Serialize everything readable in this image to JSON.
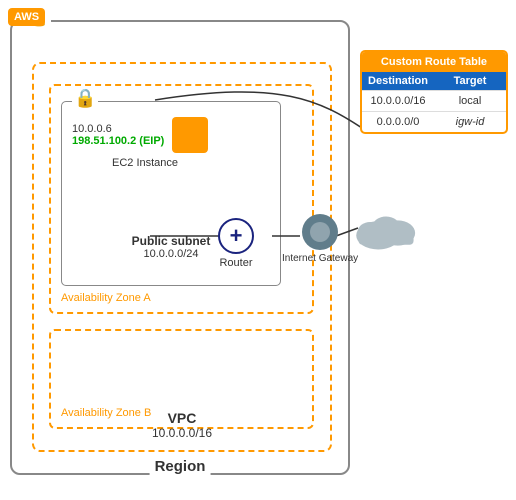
{
  "aws": {
    "badge_label": "AWS"
  },
  "region": {
    "label": "Region"
  },
  "vpc": {
    "label": "VPC",
    "cidr": "10.0.0.0/16"
  },
  "az_a": {
    "label": "Availability Zone A"
  },
  "az_b": {
    "label": "Availability Zone B"
  },
  "subnet": {
    "label": "Public subnet",
    "cidr": "10.0.0.0/24"
  },
  "ec2": {
    "private_ip": "10.0.0.6",
    "eip": "198.51.100.2 (EIP)",
    "label": "EC2 Instance"
  },
  "router": {
    "label": "Router"
  },
  "igw": {
    "label": "Internet Gateway"
  },
  "route_table": {
    "title": "Custom Route Table",
    "col_destination": "Destination",
    "col_target": "Target",
    "rows": [
      {
        "destination": "10.0.0.0/16",
        "target": "local"
      },
      {
        "destination": "0.0.0.0/0",
        "target": "igw-id"
      }
    ]
  },
  "colors": {
    "orange": "#FF9900",
    "blue_dark": "#1565C0",
    "navy": "#1a237e",
    "green": "#00AA00"
  }
}
